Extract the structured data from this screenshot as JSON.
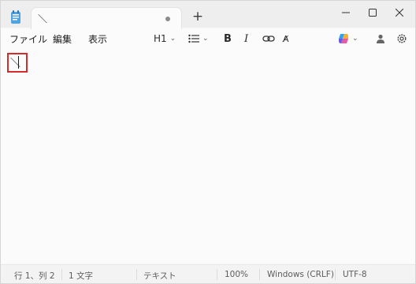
{
  "tab": {
    "title": "＼"
  },
  "menu": {
    "file": "ファイル",
    "edit": "編集",
    "view": "表示"
  },
  "toolbar": {
    "heading": "H1"
  },
  "editor": {
    "content": "＼"
  },
  "status": {
    "position": "行 1、列 2",
    "chars": "1 文字",
    "format": "テキスト",
    "zoom": "100%",
    "line_ending": "Windows (CRLF)",
    "encoding": "UTF-8"
  },
  "colors": {
    "highlight": "#d42b2b",
    "titlebar": "#eeeeee"
  }
}
